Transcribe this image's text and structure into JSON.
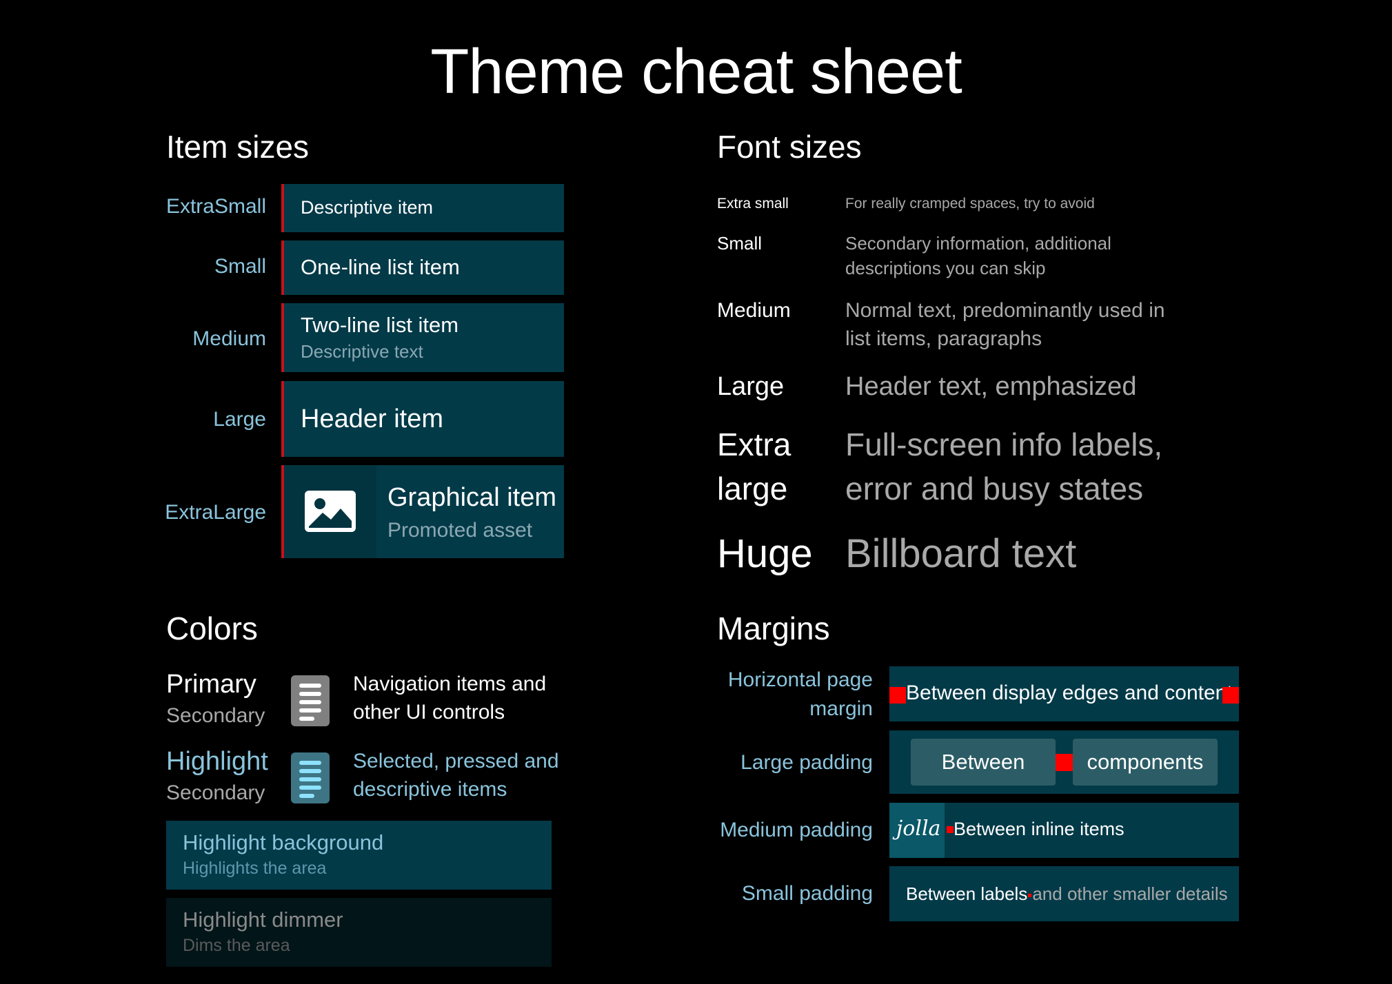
{
  "title": "Theme cheat sheet",
  "sections": {
    "item_sizes": "Item sizes",
    "font_sizes": "Font sizes",
    "colors": "Colors",
    "margins": "Margins"
  },
  "item_sizes": {
    "extra_small": {
      "label": "ExtraSmall",
      "text": "Descriptive item"
    },
    "small": {
      "label": "Small",
      "text": "One-line list item"
    },
    "medium": {
      "label": "Medium",
      "text": "Two-line list item",
      "sub": "Descriptive text"
    },
    "large": {
      "label": "Large",
      "text": "Header item"
    },
    "extra_large": {
      "label": "ExtraLarge",
      "text": "Graphical item",
      "sub": "Promoted asset",
      "icon": "image-icon"
    }
  },
  "font_sizes": {
    "extra_small": {
      "label": "Extra small",
      "desc": "For really cramped spaces, try to avoid"
    },
    "small": {
      "label": "Small",
      "desc1": "Secondary information, additional",
      "desc2": "descriptions you can skip"
    },
    "medium": {
      "label": "Medium",
      "desc1": "Normal text, predominantly used in",
      "desc2": "list items, paragraphs"
    },
    "large": {
      "label": "Large",
      "desc": "Header text, emphasized"
    },
    "extra_large": {
      "label1": "Extra",
      "label2": "large",
      "desc1": "Full-screen info labels,",
      "desc2": "error and busy states"
    },
    "huge": {
      "label": "Huge",
      "desc": "Billboard text"
    }
  },
  "colors": {
    "primary": {
      "label": "Primary",
      "secondary": "Secondary",
      "desc1": "Navigation items and",
      "desc2": "other UI controls",
      "icon": "document-icon",
      "color": "#ffffff"
    },
    "highlight": {
      "label": "Highlight",
      "secondary": "Secondary",
      "desc1": "Selected, pressed and",
      "desc2": "descriptive items",
      "icon": "document-icon",
      "color": "#8ac4dc"
    },
    "highlight_background": {
      "label": "Highlight background",
      "desc": "Highlights the area",
      "color": "#033a48"
    },
    "highlight_dimmer": {
      "label": "Highlight dimmer",
      "desc": "Dims the area",
      "color": "#021519"
    }
  },
  "margins": {
    "horizontal_page": {
      "label1": "Horizontal page",
      "label2": "margin",
      "text": "Between display edges and content"
    },
    "large_padding": {
      "label": "Large padding",
      "pill1": "Between",
      "pill2": "components"
    },
    "medium_padding": {
      "label": "Medium padding",
      "logo": "jolla",
      "text": "Between inline items"
    },
    "small_padding": {
      "label": "Small padding",
      "text1": "Between labels",
      "text2": "and other smaller details"
    }
  },
  "accent_colors": {
    "marker": "#c8101a",
    "highlight": "#8ac4dc",
    "background": "#033a48"
  }
}
